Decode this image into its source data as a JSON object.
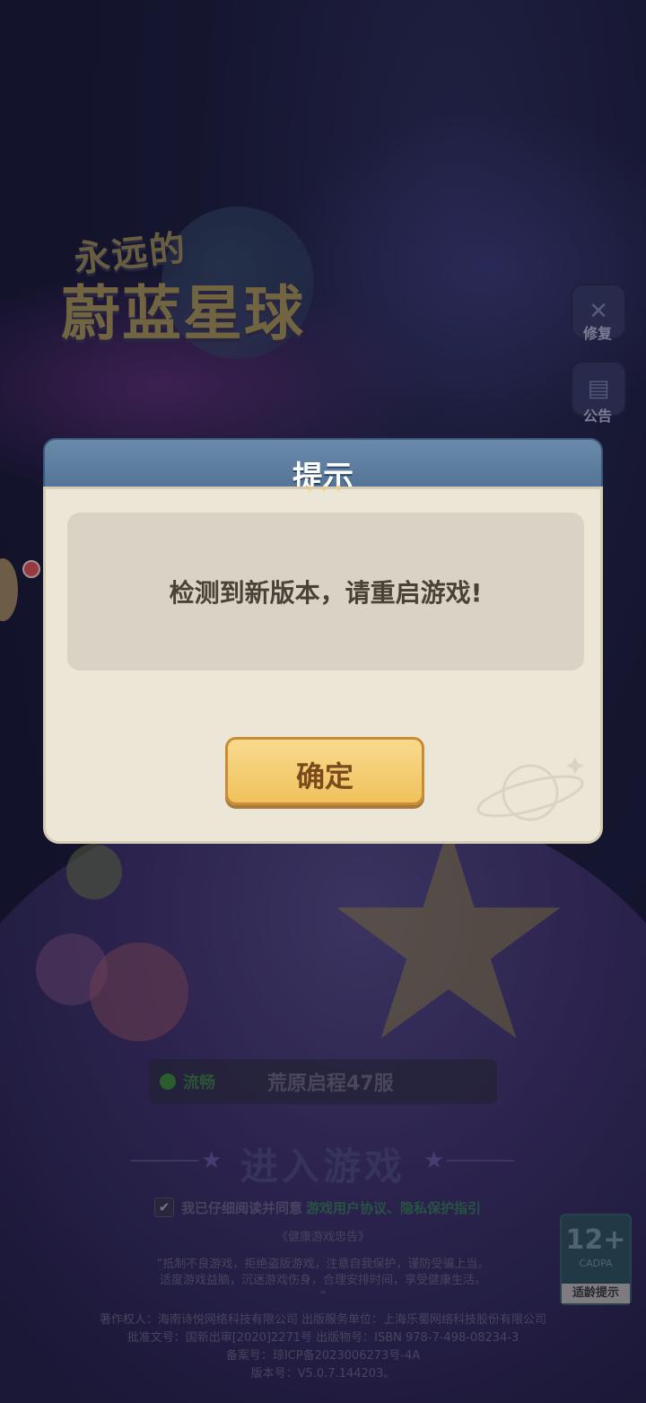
{
  "logo": {
    "line1": "永远的",
    "line2": "蔚蓝星球"
  },
  "side_buttons": [
    {
      "label": "修复",
      "icon": "wrench-icon"
    },
    {
      "label": "公告",
      "icon": "announcement-icon"
    }
  ],
  "server": {
    "status": "流畅",
    "name": "荒原启程47服",
    "status_color": "#3f8b3a"
  },
  "enter_game": {
    "label": "进入游戏"
  },
  "agreement": {
    "prefix": "我已仔细阅读并同意",
    "links": "游戏用户协议、隐私保护指引",
    "checked": true
  },
  "health": {
    "title": "《健康游戏忠告》",
    "line1": "“抵制不良游戏，拒绝盗版游戏，注意自我保护，谨防受骗上当。",
    "line2": "适度游戏益脑，沉迷游戏伤身，合理安排时间，享受健康生活。",
    "line3": "”"
  },
  "copyright": {
    "line1": "著作权人：海南诗悦网络科技有限公司 出版服务单位：上海乐蜀网络科技股份有限公司",
    "line2": "批准文号：国新出审[2020]2271号 出版物号：ISBN 978-7-498-08234-3",
    "line3": "备案号：琼ICP备2023006273号-4A",
    "line4": "版本号：V5.0.7.144203。"
  },
  "age_rating": {
    "number": "12+",
    "org": "CADPA",
    "label": "适龄提示"
  },
  "dialog": {
    "title": "提示",
    "message": "检测到新版本，请重启游戏!",
    "confirm_label": "确定"
  },
  "colors": {
    "dialog_header": "#5a7a9e",
    "dialog_body": "#ece6d6",
    "button_gold": "#f3c865",
    "button_text": "#7a4a1c"
  }
}
